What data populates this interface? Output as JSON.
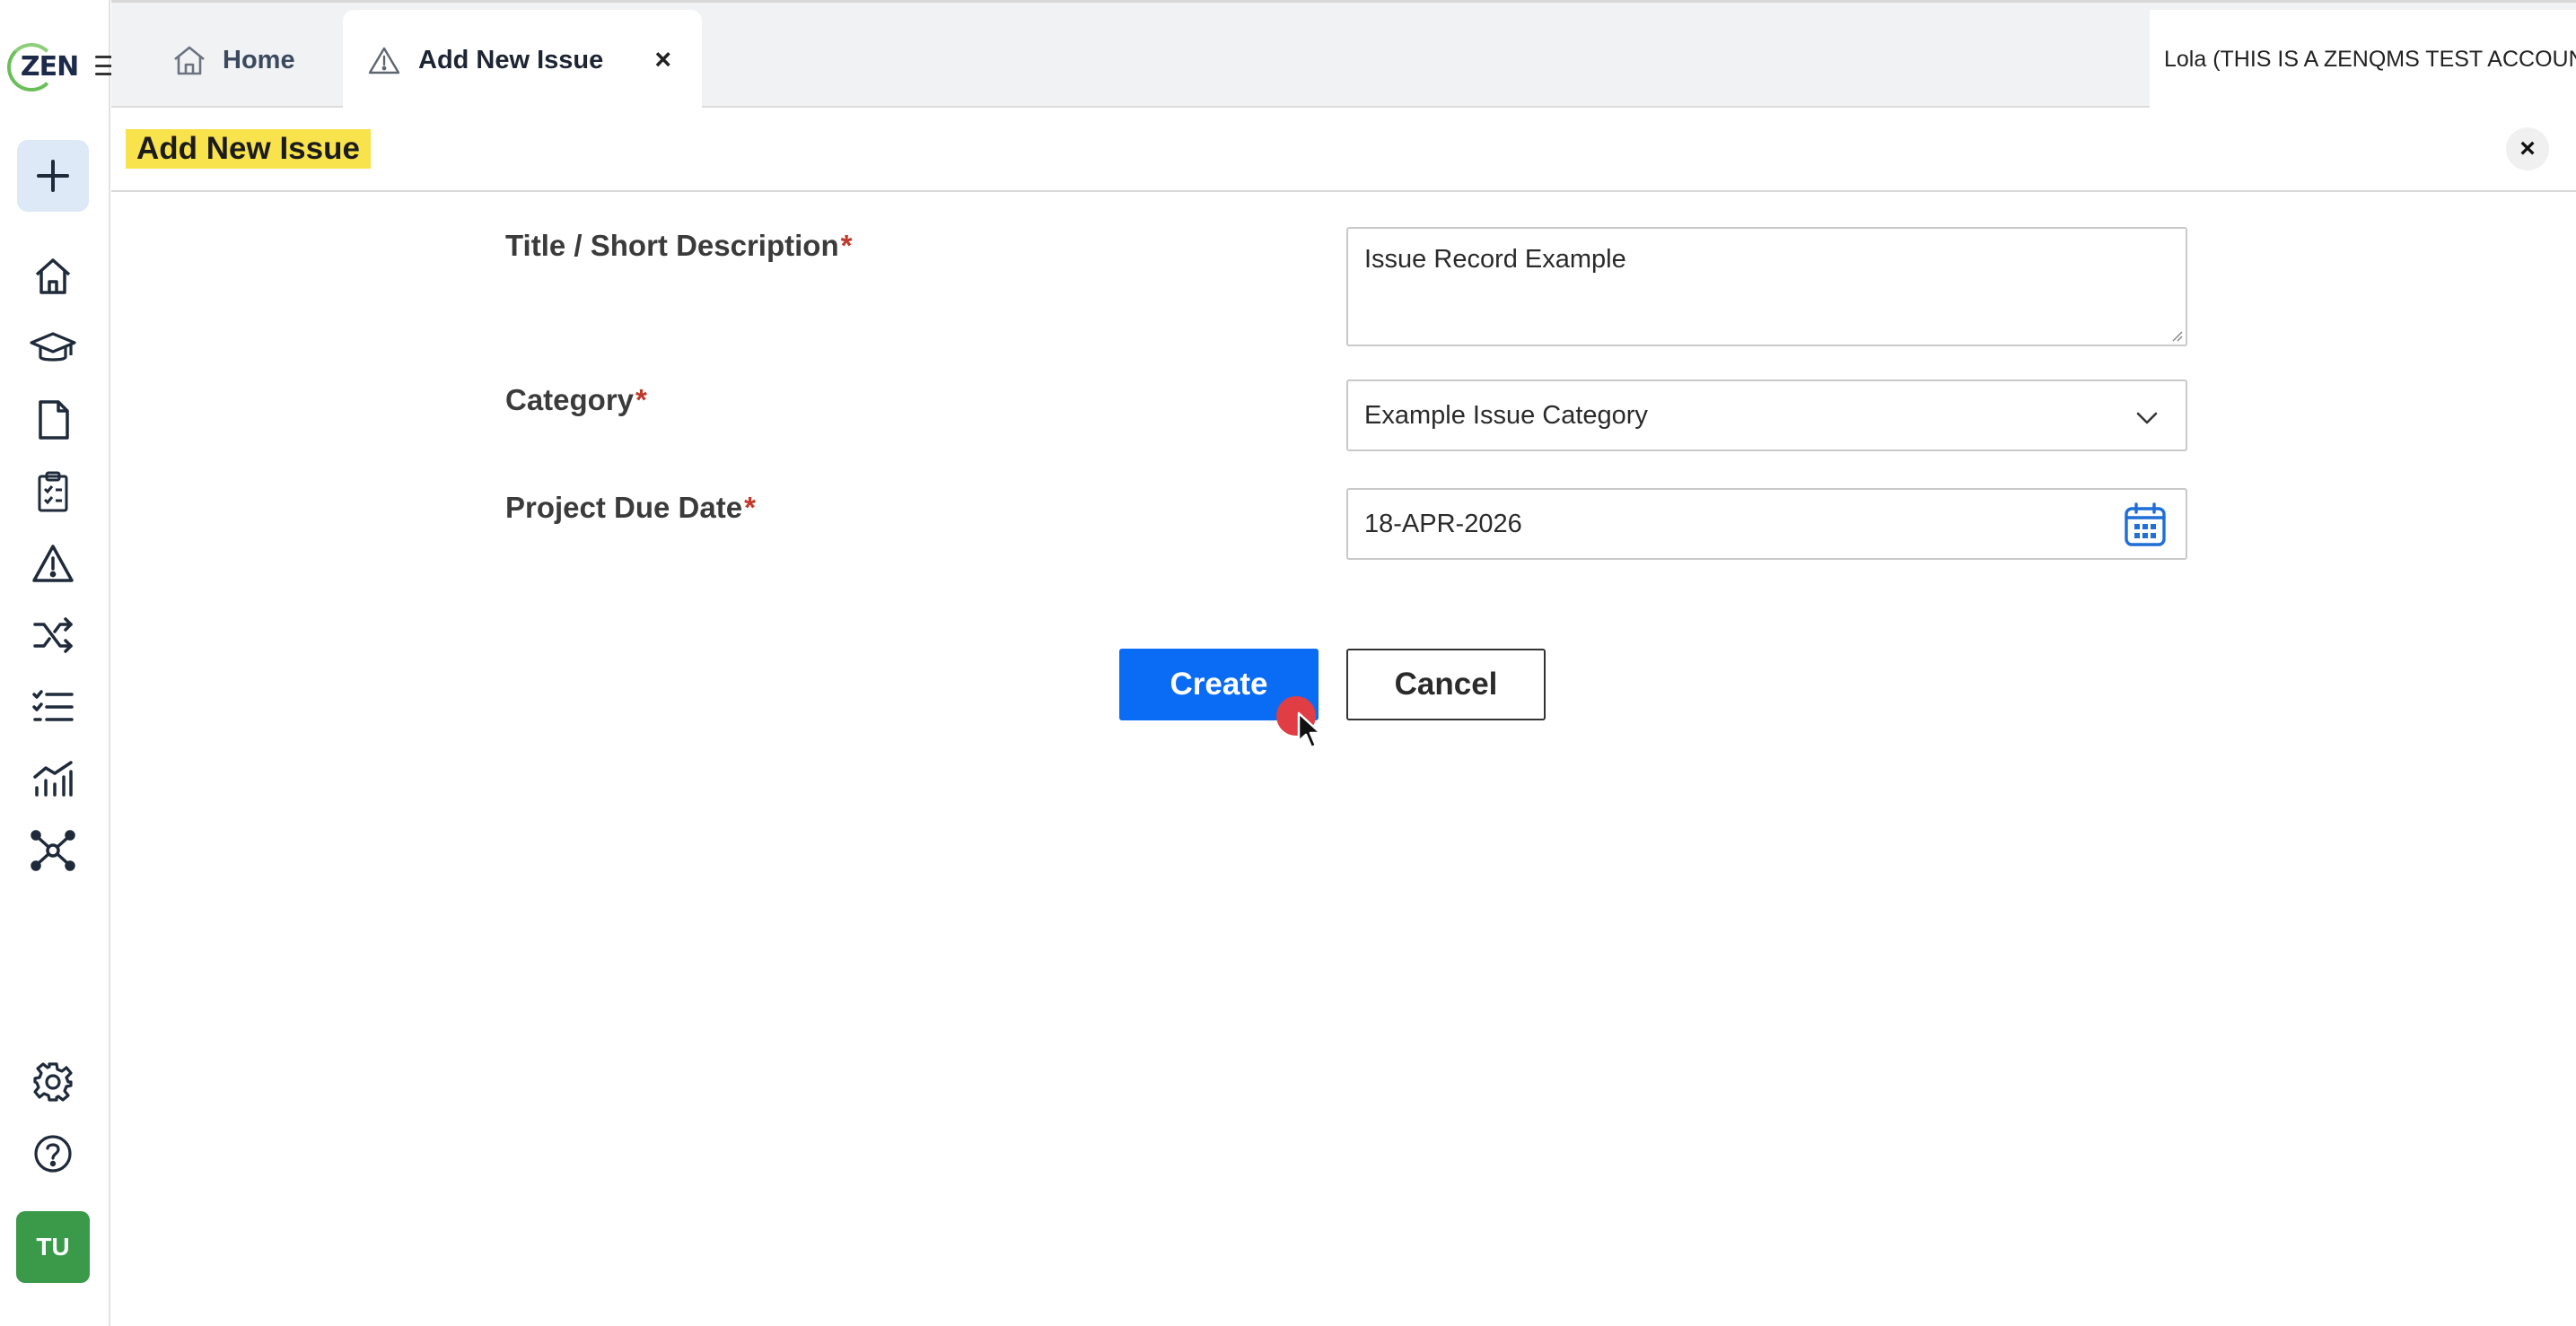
{
  "logo": {
    "text": "ZEN"
  },
  "tabs": {
    "home_label": "Home",
    "active_label": "Add New Issue",
    "close_symbol": "×"
  },
  "user": {
    "name": "Lola (THIS IS A ZENQMS TEST ACCOUNT)"
  },
  "header": {
    "title": "Add New Issue",
    "close_symbol": "×"
  },
  "form": {
    "title_label": "Title / Short Description",
    "title_value": "Issue Record Example",
    "category_label": "Category",
    "category_value": "Example Issue Category",
    "due_date_label": "Project Due Date",
    "due_date_value": "18-APR-2026",
    "required_marker": "*"
  },
  "actions": {
    "create_label": "Create",
    "cancel_label": "Cancel"
  },
  "sidebar": {
    "icons": [
      "plus-icon",
      "home-icon",
      "graduation-cap-icon",
      "document-icon",
      "clipboard-checklist-icon",
      "warning-triangle-icon",
      "shuffle-icon",
      "checklist-icon",
      "analytics-chart-icon",
      "network-hub-icon",
      "gear-icon",
      "help-icon"
    ],
    "avatar_initials": "TU"
  },
  "colors": {
    "primary_button": "#0a6cf5",
    "title_highlight": "#f9e34c",
    "required": "#c0392b",
    "avatar": "#3a9a4a",
    "calendar_icon": "#1f6fd6"
  }
}
